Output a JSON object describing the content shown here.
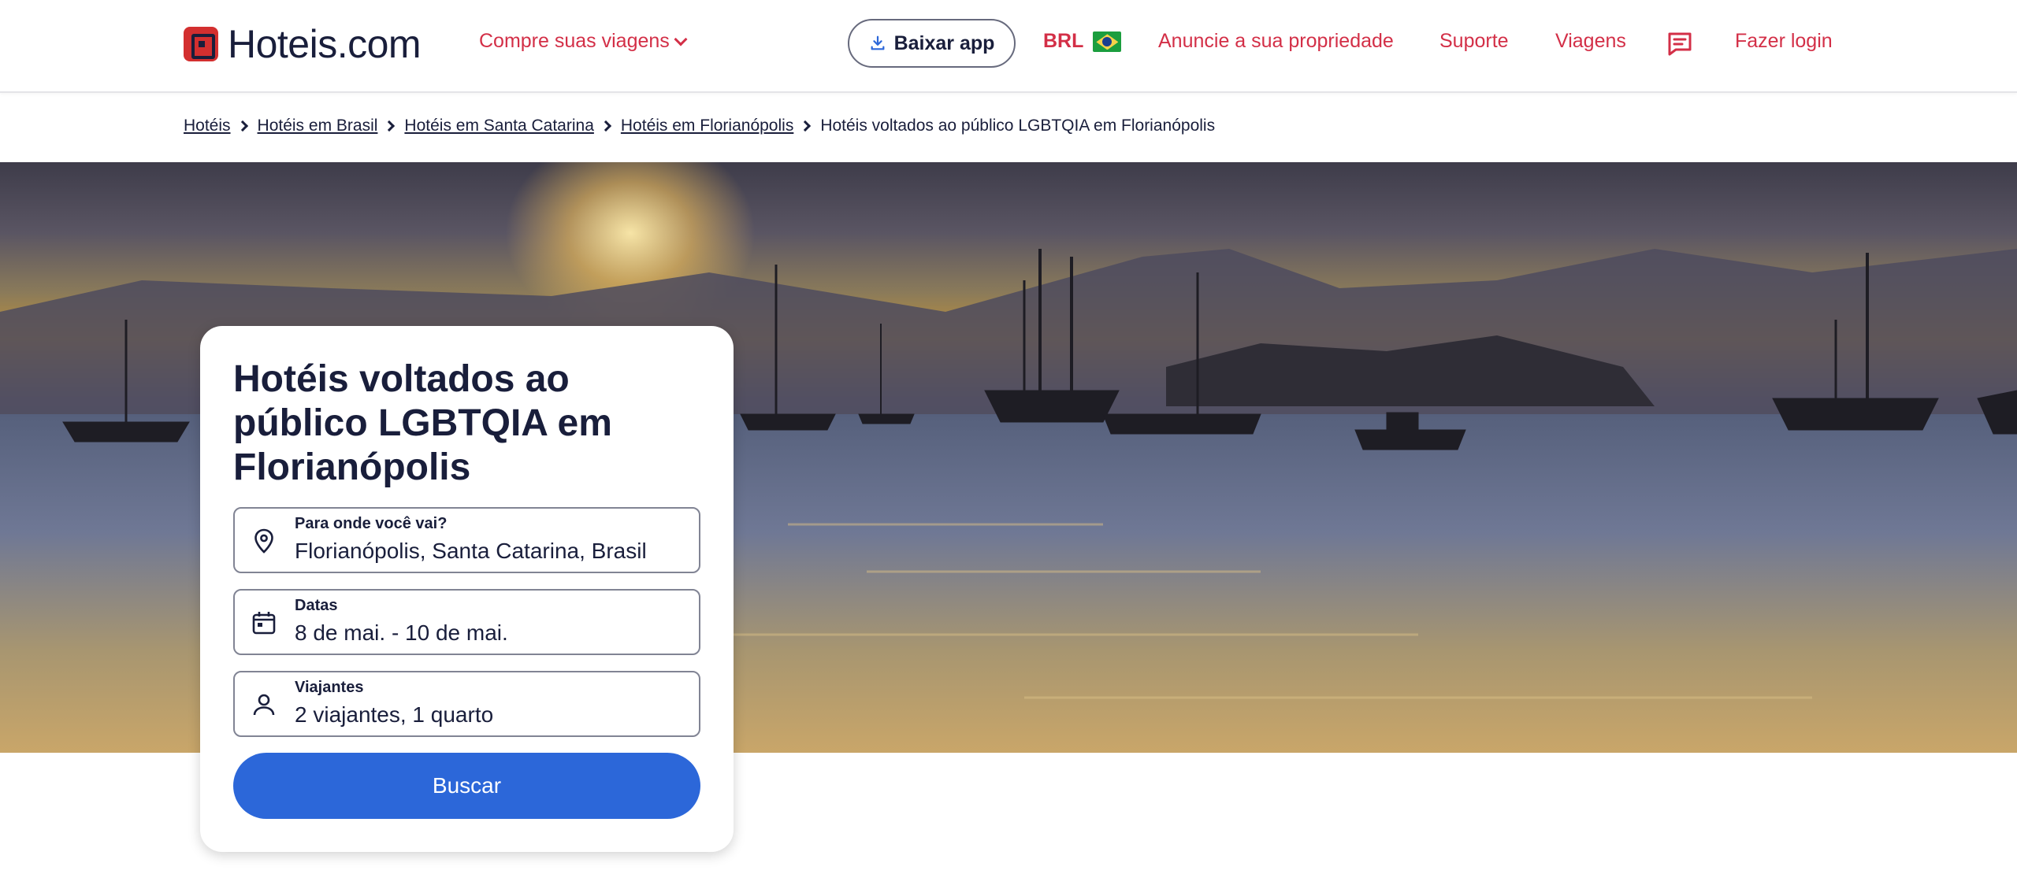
{
  "header": {
    "logo_text": "Hoteis.com",
    "shop_label": "Compre suas viagens",
    "app_button_label": "Baixar app",
    "currency_label": "BRL",
    "list_property_label": "Anuncie a sua propriedade",
    "support_label": "Suporte",
    "trips_label": "Viagens",
    "login_label": "Fazer login"
  },
  "breadcrumb": {
    "items": [
      "Hotéis",
      "Hotéis em Brasil",
      "Hotéis em Santa Catarina",
      "Hotéis em Florianópolis"
    ],
    "current": "Hotéis voltados ao público LGBTQIA em Florianópolis"
  },
  "search": {
    "title": "Hotéis voltados ao público LGBTQIA em Florianópolis",
    "destination_label": "Para onde você vai?",
    "destination_value": "Florianópolis, Santa Catarina, Brasil",
    "dates_label": "Datas",
    "dates_value": "8 de mai. - 10 de mai.",
    "travelers_label": "Viajantes",
    "travelers_value": "2 viajantes, 1 quarto",
    "button_label": "Buscar"
  },
  "colors": {
    "brand_red": "#d32f47",
    "primary_blue": "#2c67d9",
    "text_dark": "#191e3b"
  },
  "icons": [
    "chevron-down-icon",
    "download-icon",
    "brazil-flag-icon",
    "chat-icon",
    "location-pin-icon",
    "calendar-icon",
    "person-icon"
  ]
}
